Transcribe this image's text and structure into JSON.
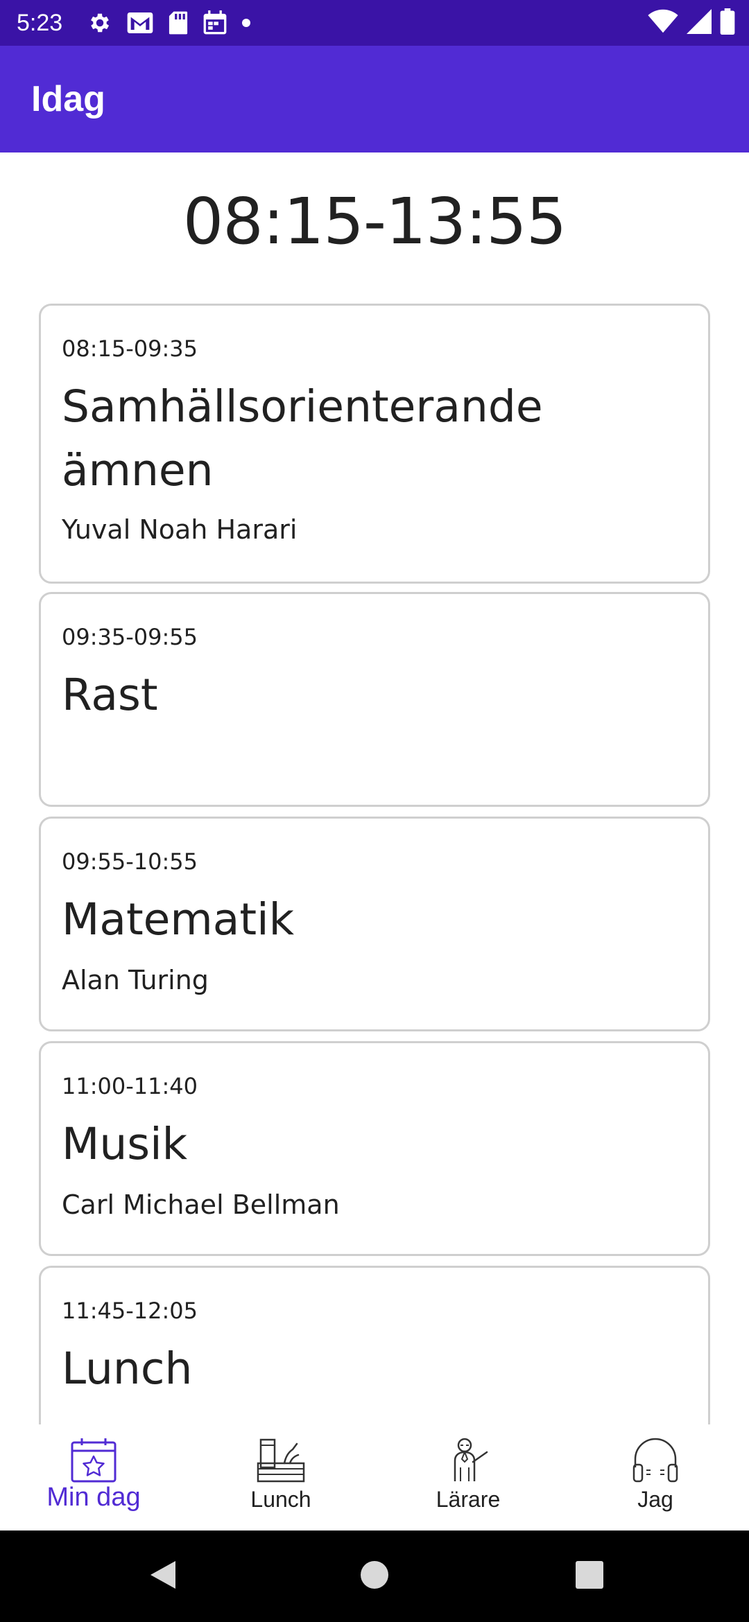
{
  "status_bar": {
    "time": "5:23",
    "left_icons": [
      "gear-icon",
      "gmail-icon",
      "sd-card-icon",
      "calendar-icon",
      "dot-icon"
    ],
    "right_icons": [
      "wifi-icon",
      "signal-icon",
      "battery-icon"
    ]
  },
  "app_bar": {
    "title": "Idag"
  },
  "schedule": {
    "day_range": "08:15-13:55",
    "lessons": [
      {
        "time": "08:15-09:35",
        "subject": "Samhällsorienterande ämnen",
        "teacher": "Yuval Noah Harari"
      },
      {
        "time": "09:35-09:55",
        "subject": "Rast",
        "teacher": ""
      },
      {
        "time": "09:55-10:55",
        "subject": "Matematik",
        "teacher": "Alan Turing"
      },
      {
        "time": "11:00-11:40",
        "subject": "Musik",
        "teacher": "Carl Michael Bellman"
      },
      {
        "time": "11:45-12:05",
        "subject": "Lunch",
        "teacher": ""
      }
    ]
  },
  "bottom_nav": {
    "items": [
      {
        "label": "Min dag",
        "icon": "calendar-star-icon",
        "active": true
      },
      {
        "label": "Lunch",
        "icon": "lunch-box-icon",
        "active": false
      },
      {
        "label": "Lärare",
        "icon": "teacher-icon",
        "active": false
      },
      {
        "label": "Jag",
        "icon": "headphones-icon",
        "active": false
      }
    ]
  },
  "colors": {
    "status_bar": "#3a13a6",
    "app_bar": "#512bd4",
    "accent": "#512bd4",
    "card_border": "#cfcfcf",
    "text": "#212121"
  }
}
